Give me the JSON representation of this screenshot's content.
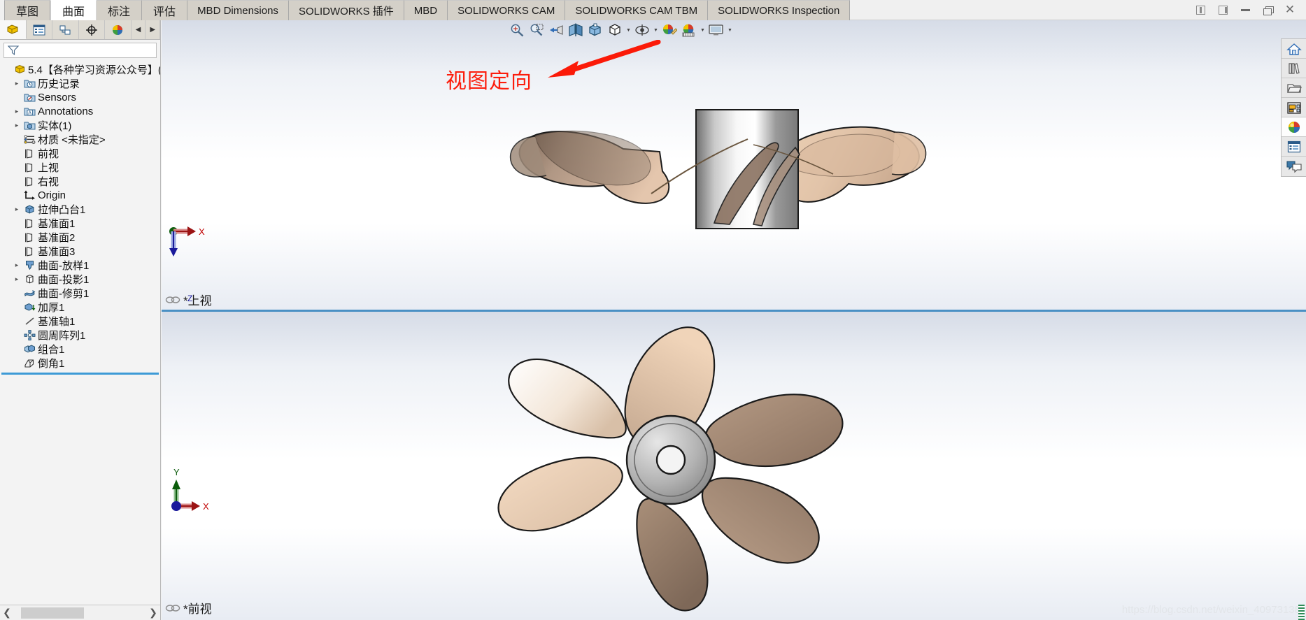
{
  "window": {
    "controls": [
      {
        "name": "restore-left-icon",
        "glyph": "box-left"
      },
      {
        "name": "restore-right-icon",
        "glyph": "box-right"
      },
      {
        "name": "minimize-icon",
        "glyph": "min"
      },
      {
        "name": "restore-icon",
        "glyph": "rest"
      },
      {
        "name": "close-icon",
        "glyph": "×"
      }
    ]
  },
  "ribbon": {
    "tabs": [
      {
        "label": "草图",
        "cjk": true,
        "active": false
      },
      {
        "label": "曲面",
        "cjk": true,
        "active": true
      },
      {
        "label": "标注",
        "cjk": true,
        "active": false
      },
      {
        "label": "评估",
        "cjk": true,
        "active": false
      },
      {
        "label": "MBD Dimensions",
        "cjk": false,
        "active": false
      },
      {
        "label": "SOLIDWORKS 插件",
        "cjk": false,
        "active": false
      },
      {
        "label": "MBD",
        "cjk": false,
        "active": false
      },
      {
        "label": "SOLIDWORKS CAM",
        "cjk": false,
        "active": false
      },
      {
        "label": "SOLIDWORKS CAM TBM",
        "cjk": false,
        "active": false
      },
      {
        "label": "SOLIDWORKS Inspection",
        "cjk": false,
        "active": false
      }
    ]
  },
  "feature_manager": {
    "tabs": [
      {
        "name": "feature-manager-tab",
        "icon": "yellow-block-icon",
        "active": true
      },
      {
        "name": "property-manager-tab",
        "icon": "list-panel-icon",
        "active": false
      },
      {
        "name": "configuration-manager-tab",
        "icon": "config-icon",
        "active": false
      },
      {
        "name": "dimxpert-manager-tab",
        "icon": "target-icon",
        "active": false
      },
      {
        "name": "display-manager-tab",
        "icon": "color-sphere-icon",
        "active": false
      }
    ],
    "nav_prev": "◀",
    "nav_next": "▶",
    "filter_placeholder": "",
    "filter_icon": "filter-funnel-icon",
    "tree": [
      {
        "label": "5.4【各种学习资源公众号】(",
        "icon": "part-icon",
        "expand": "",
        "indent": 0,
        "root": true
      },
      {
        "label": "历史记录",
        "icon": "history-folder-icon",
        "expand": "▸",
        "indent": 1
      },
      {
        "label": "Sensors",
        "icon": "sensors-folder-icon",
        "expand": "",
        "indent": 1
      },
      {
        "label": "Annotations",
        "icon": "annotations-folder-icon",
        "expand": "▸",
        "indent": 1
      },
      {
        "label": "实体(1)",
        "icon": "solid-bodies-folder-icon",
        "expand": "▸",
        "indent": 1
      },
      {
        "label": "材质 <未指定>",
        "icon": "material-icon",
        "expand": "",
        "indent": 1
      },
      {
        "label": "前视",
        "icon": "plane-icon",
        "expand": "",
        "indent": 1
      },
      {
        "label": "上视",
        "icon": "plane-icon",
        "expand": "",
        "indent": 1
      },
      {
        "label": "右视",
        "icon": "plane-icon",
        "expand": "",
        "indent": 1
      },
      {
        "label": "Origin",
        "icon": "origin-icon",
        "expand": "",
        "indent": 1
      },
      {
        "label": "拉伸凸台1",
        "icon": "extrude-boss-icon",
        "expand": "▸",
        "indent": 1
      },
      {
        "label": "基准面1",
        "icon": "plane-icon",
        "expand": "",
        "indent": 1
      },
      {
        "label": "基准面2",
        "icon": "plane-icon",
        "expand": "",
        "indent": 1
      },
      {
        "label": "基准面3",
        "icon": "plane-icon",
        "expand": "",
        "indent": 1
      },
      {
        "label": "曲面-放样1",
        "icon": "surface-loft-icon",
        "expand": "▸",
        "indent": 1
      },
      {
        "label": "曲面-投影1",
        "icon": "surface-project-icon",
        "expand": "▸",
        "indent": 1
      },
      {
        "label": "曲面-修剪1",
        "icon": "surface-trim-icon",
        "expand": "",
        "indent": 1
      },
      {
        "label": "加厚1",
        "icon": "thicken-icon",
        "expand": "",
        "indent": 1
      },
      {
        "label": "基准轴1",
        "icon": "axis-icon",
        "expand": "",
        "indent": 1
      },
      {
        "label": "圆周阵列1",
        "icon": "circular-pattern-icon",
        "expand": "",
        "indent": 1
      },
      {
        "label": "组合1",
        "icon": "combine-icon",
        "expand": "",
        "indent": 1
      },
      {
        "label": "倒角1",
        "icon": "chamfer-icon",
        "expand": "",
        "indent": 1
      }
    ],
    "hscroll": {
      "left_arrow": "❮",
      "right_arrow": "❯"
    }
  },
  "view_toolbar": {
    "items": [
      {
        "name": "zoom-to-fit-icon",
        "caret": false
      },
      {
        "name": "zoom-to-area-icon",
        "caret": false
      },
      {
        "name": "previous-view-icon",
        "caret": false
      },
      {
        "name": "section-view-icon",
        "caret": false
      },
      {
        "name": "view-orientation-icon",
        "caret": false,
        "highlighted": true
      },
      {
        "name": "display-style-icon",
        "caret": true
      },
      {
        "name": "hide-show-items-icon",
        "caret": true
      },
      {
        "name": "edit-appearance-icon",
        "caret": false
      },
      {
        "name": "apply-scene-icon",
        "caret": true
      },
      {
        "name": "view-settings-icon",
        "caret": true
      }
    ]
  },
  "annotation": {
    "text": "视图定向",
    "color": "#fc1d0c",
    "arrow_color": "#fb1a08"
  },
  "viewports": {
    "top": {
      "label": "*上视",
      "lock_icon": "linked-views-icon",
      "triad": {
        "axes": [
          {
            "name": "x-axis",
            "label": "X",
            "color": "#c00000"
          },
          {
            "name": "z-axis",
            "label": "",
            "color": "#0000c8"
          }
        ],
        "origin_color": "#006400"
      }
    },
    "bottom": {
      "label": "*前视",
      "lock_icon": "linked-views-icon",
      "triad": {
        "axes": [
          {
            "name": "y-axis",
            "label": "Y",
            "color": "#006400"
          },
          {
            "name": "x-axis",
            "label": "X",
            "color": "#c00000"
          }
        ],
        "origin_color": "#0000c8"
      }
    },
    "splitter_color": "#4a90c4"
  },
  "model": {
    "name": "propeller",
    "blade_light": "#f2cdb0",
    "blade_mid": "#c8ab95",
    "blade_dark": "#8d7564",
    "hub_light": "#ffffff",
    "hub_mid": "#b5b5b5",
    "hub_dark": "#6f6f6f",
    "outline": "#1a1a1a"
  },
  "task_pane": {
    "items": [
      {
        "name": "solidworks-resources-icon",
        "label": "SOLIDWORKS Resources"
      },
      {
        "name": "design-library-icon",
        "label": "Design Library"
      },
      {
        "name": "file-explorer-icon",
        "label": "File Explorer"
      },
      {
        "name": "view-palette-icon",
        "label": "View Palette"
      },
      {
        "name": "appearances-scenes-icon",
        "label": "Appearances, Scenes and Decals"
      },
      {
        "name": "custom-properties-icon",
        "label": "Custom Properties"
      },
      {
        "name": "solidworks-forum-icon",
        "label": "SOLIDWORKS Forum"
      }
    ]
  },
  "watermark": {
    "text": "https://blog.csdn.net/weixin_40973138"
  }
}
